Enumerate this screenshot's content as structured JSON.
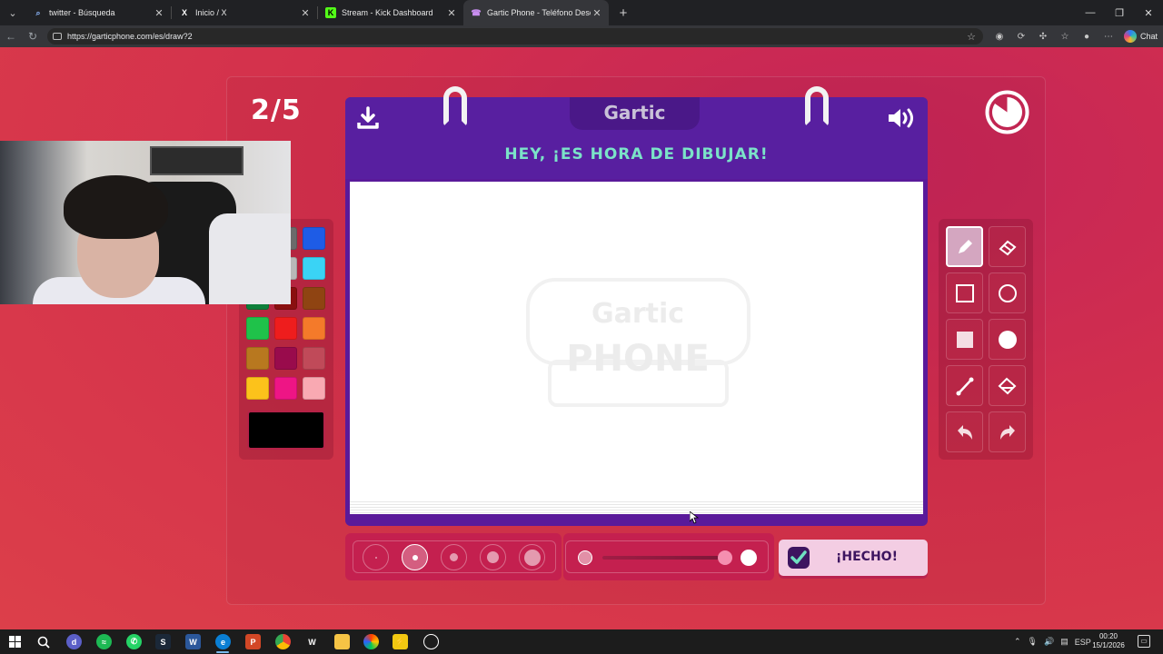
{
  "browser": {
    "tabs": [
      {
        "title": "twitter - Búsqueda",
        "icon": "search-icon",
        "active": false
      },
      {
        "title": "Inicio / X",
        "icon": "x-logo-icon",
        "active": false
      },
      {
        "title": "Stream - Kick Dashboard",
        "icon": "kick-logo-icon",
        "active": false
      },
      {
        "title": "Gartic Phone - Teléfono Descompuesto",
        "icon": "gartic-icon",
        "active": true
      }
    ],
    "new_tab_label": "+",
    "url": "https://garticphone.com/es/draw?2",
    "chat_label": "Chat"
  },
  "game": {
    "round_counter": "2/5",
    "logo_text": "Gartic",
    "prompt": "HEY, ¡ES HORA DE DIBUJAR!",
    "done_label": "¡HECHO!",
    "watermark_top": "Gartic",
    "watermark_bottom": "PHONE",
    "palette": [
      "#1a1a1a",
      "#6b6b6b",
      "#1e5ce6",
      "#ffffff",
      "#b8b8b8",
      "#3ad3f5",
      "#0e7f3a",
      "#8a1010",
      "#8f4412",
      "#1fc24a",
      "#ee1d1d",
      "#f47a2a",
      "#b8781f",
      "#990b4c",
      "#c04a59",
      "#fcc21b",
      "#ee1585",
      "#f9a9b2"
    ],
    "current_color": "#000000",
    "selected_tool": "pencil",
    "selected_brush_size_index": 1,
    "opacity_percent": 100
  },
  "taskbar": {
    "clock_time": "00:20",
    "clock_date": "15/1/2026",
    "language": "ESP"
  },
  "colors": {
    "page_bg": "#d3304c",
    "board_purple": "#581fa0",
    "prompt_teal": "#7be3c8",
    "done_bg": "#f3cde3"
  }
}
